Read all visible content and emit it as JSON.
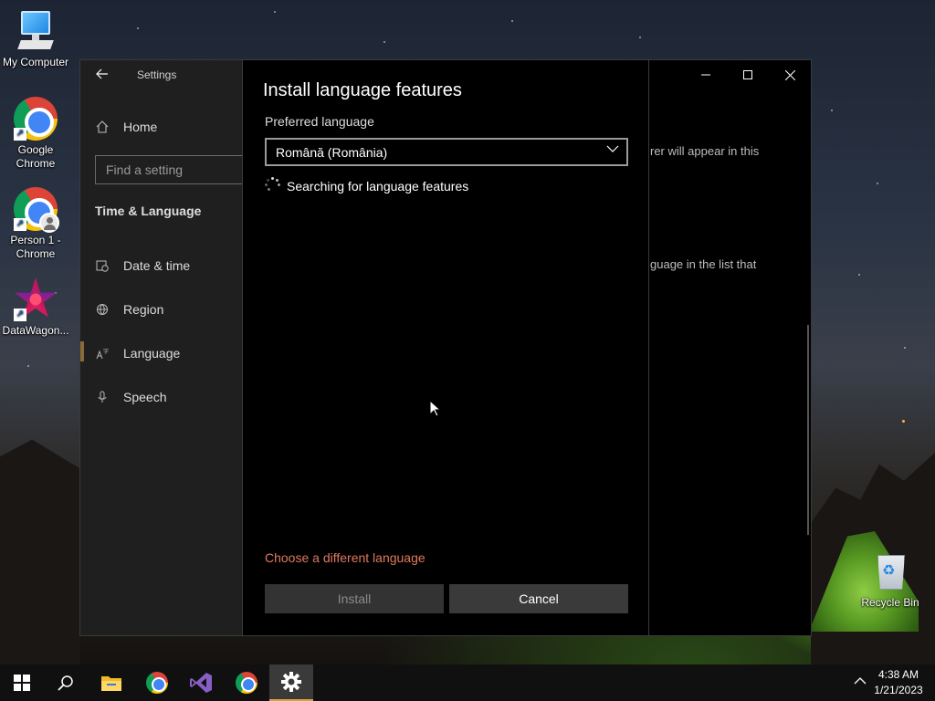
{
  "desktop": {
    "icons": [
      {
        "label": "My Computer"
      },
      {
        "label": "Google Chrome"
      },
      {
        "label": "Person 1 - Chrome"
      },
      {
        "label": "DataWagon..."
      },
      {
        "label": "Recycle Bin"
      }
    ]
  },
  "window": {
    "title": "Settings",
    "minimize_icon": "minimize-icon",
    "maximize_icon": "maximize-icon",
    "close_icon": "close-icon"
  },
  "sidebar": {
    "home_label": "Home",
    "search_placeholder": "Find a setting",
    "section_title": "Time & Language",
    "items": [
      {
        "label": "Date & time",
        "icon": "calendar-clock-icon"
      },
      {
        "label": "Region",
        "icon": "globe-icon"
      },
      {
        "label": "Language",
        "icon": "language-icon",
        "selected": true
      },
      {
        "label": "Speech",
        "icon": "microphone-icon"
      }
    ]
  },
  "background_content": {
    "line1": "rer will appear in this",
    "line2": "guage in the list that"
  },
  "dialog": {
    "title": "Install language features",
    "preferred_label": "Preferred language",
    "selected_language": "Română (România)",
    "status": "Searching for language features",
    "choose_link": "Choose a different language",
    "install_label": "Install",
    "cancel_label": "Cancel"
  },
  "taskbar": {
    "items": [
      "start-icon",
      "search-icon",
      "file-explorer-icon",
      "chrome-icon",
      "visual-studio-icon",
      "chrome-icon",
      "settings-icon"
    ],
    "time": "4:38 AM",
    "date": "1/21/2023"
  },
  "colors": {
    "accent_link": "#e07a5f",
    "taskbar_active": "#e0a040",
    "dialog_bg": "#000000",
    "sidebar_bg": "#1f1f1f"
  }
}
